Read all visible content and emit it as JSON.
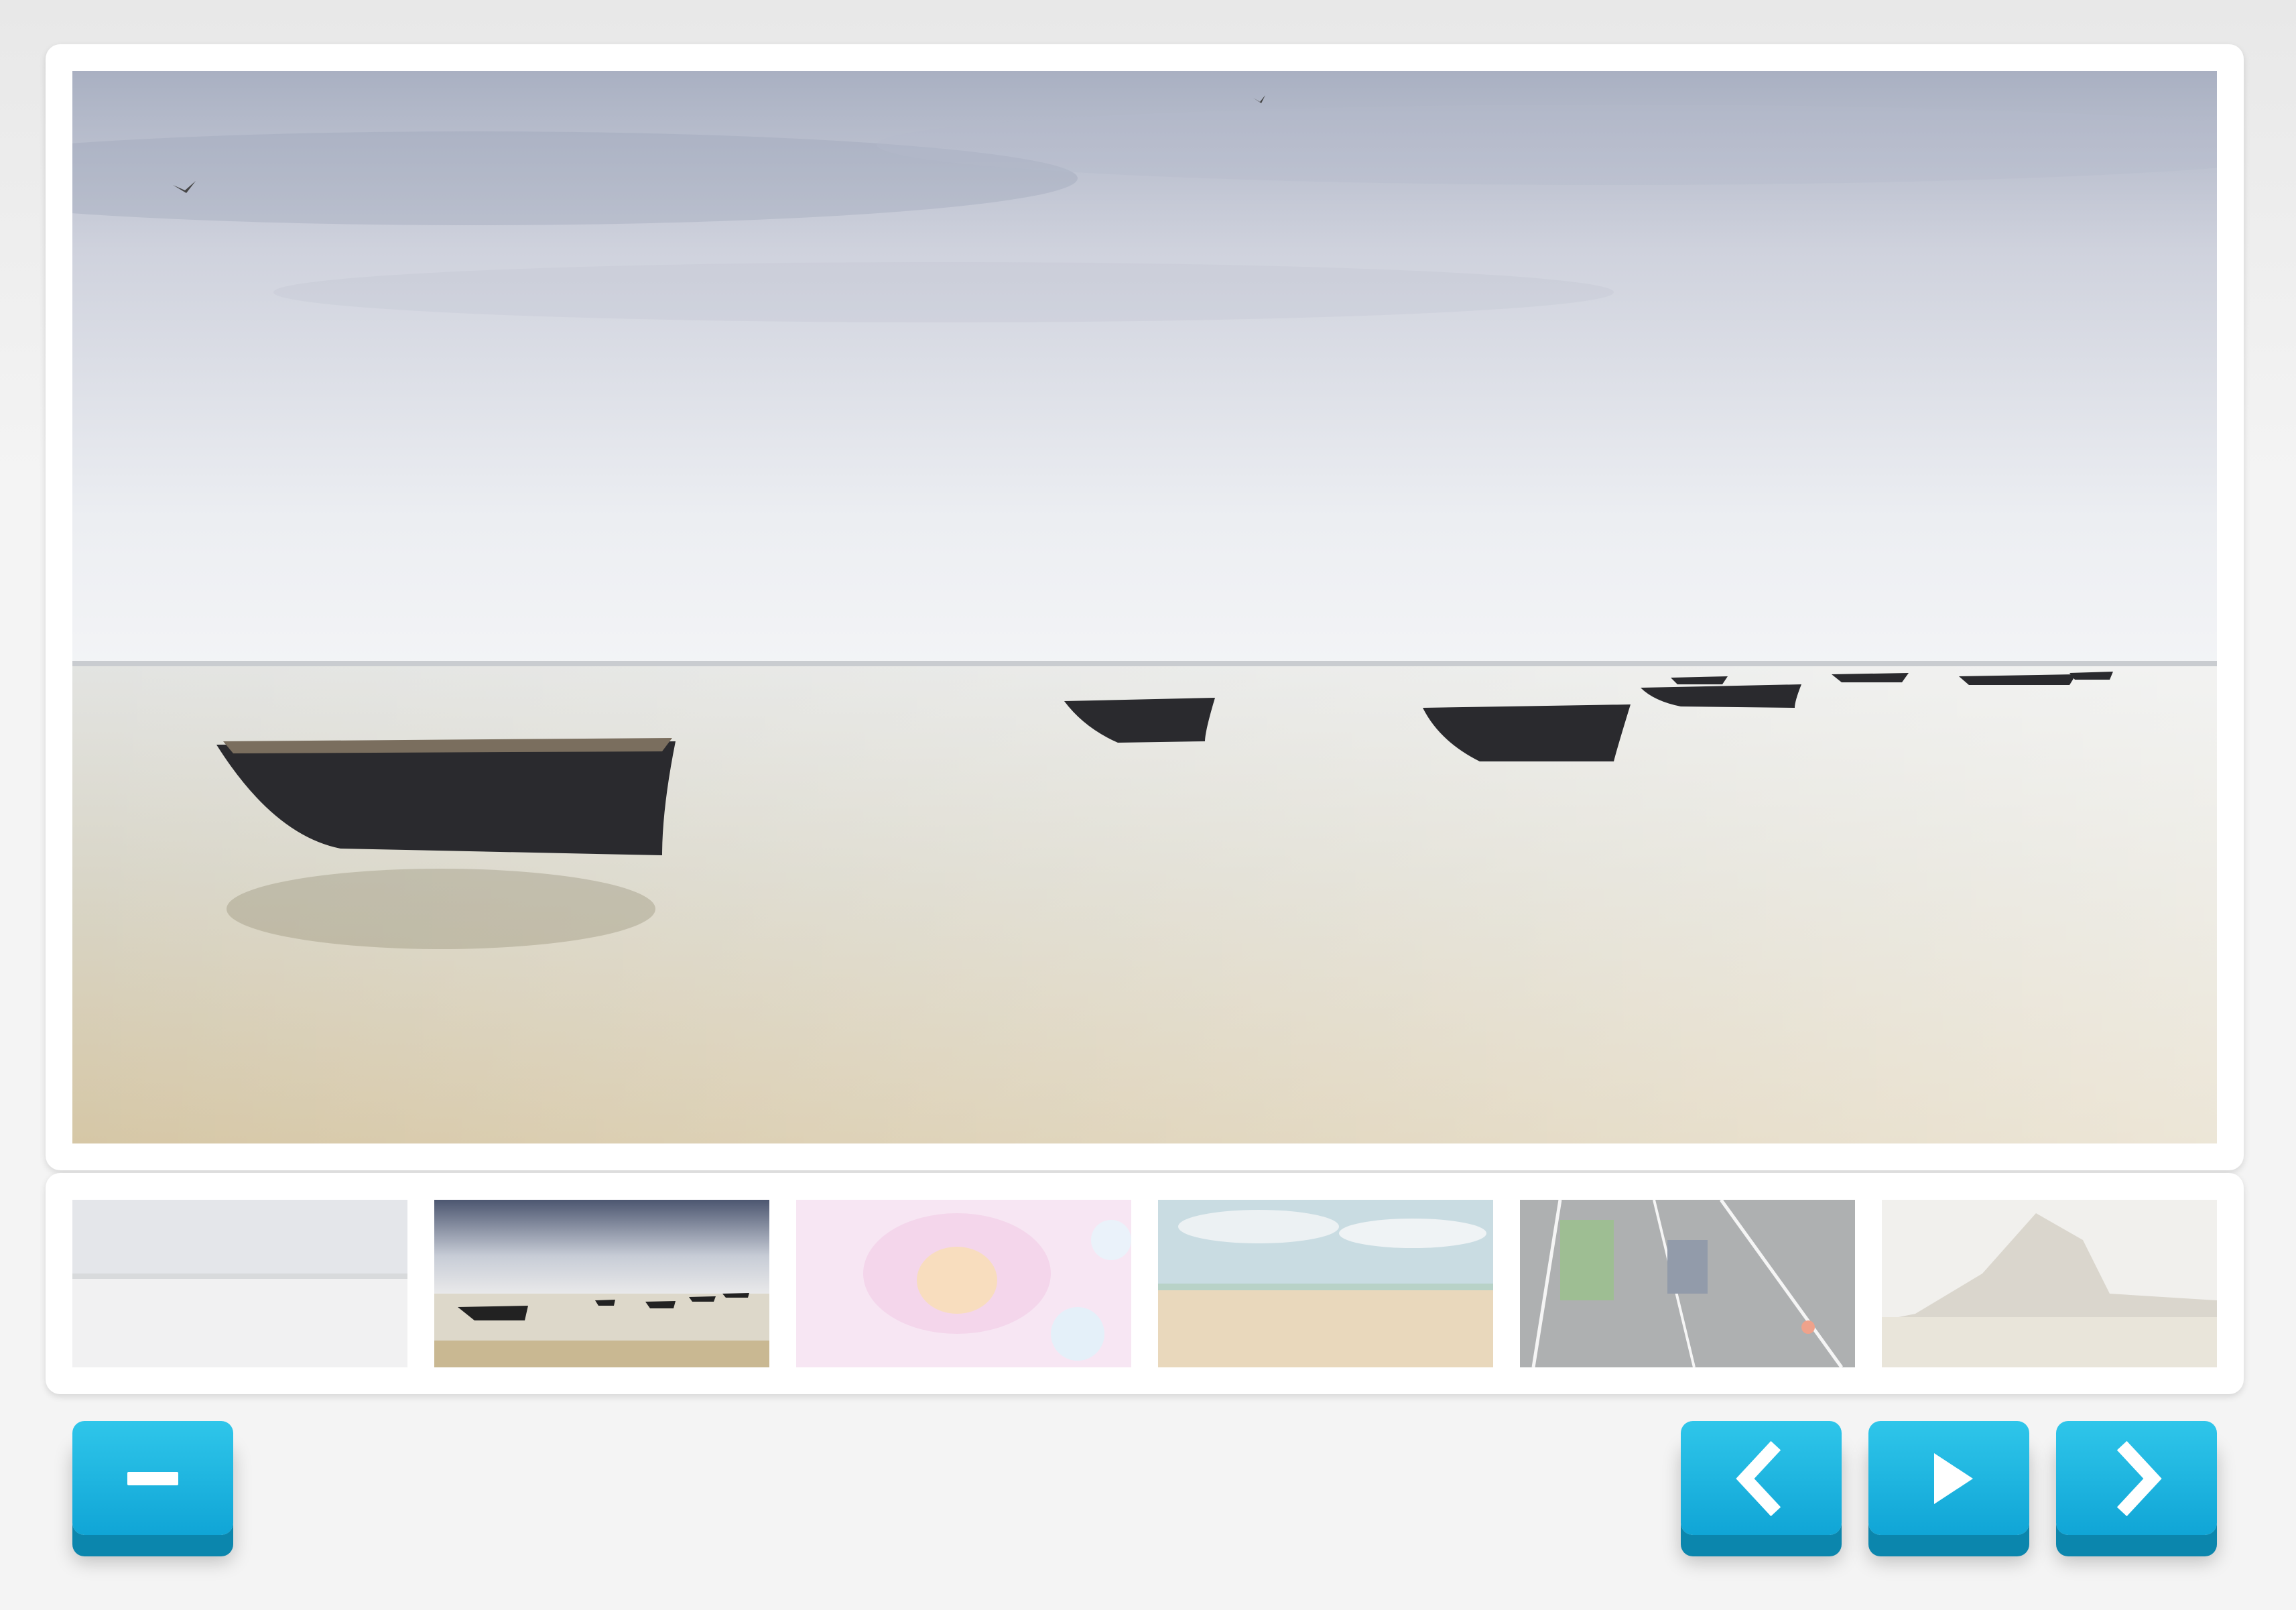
{
  "gallery": {
    "main_image": {
      "subject": "boats-on-calm-sea",
      "alt": ""
    },
    "thumbnails": [
      {
        "subject": "misty-shore",
        "active": false
      },
      {
        "subject": "boats-on-sea",
        "active": true
      },
      {
        "subject": "pink-flower",
        "active": false
      },
      {
        "subject": "sandy-beach",
        "active": false
      },
      {
        "subject": "road-traffic",
        "active": false
      },
      {
        "subject": "rock-coast",
        "active": false
      }
    ]
  },
  "controls": {
    "collapse": {
      "icon": "minus-icon"
    },
    "previous": {
      "icon": "chevron-left-icon"
    },
    "play": {
      "icon": "play-icon"
    },
    "next": {
      "icon": "chevron-right-icon"
    }
  },
  "colors": {
    "button_top": "#2fc6ea",
    "button_bottom": "#10a5d6",
    "button_edge": "#0b86ad",
    "panel": "#ffffff",
    "background": "#f4f4f4"
  }
}
